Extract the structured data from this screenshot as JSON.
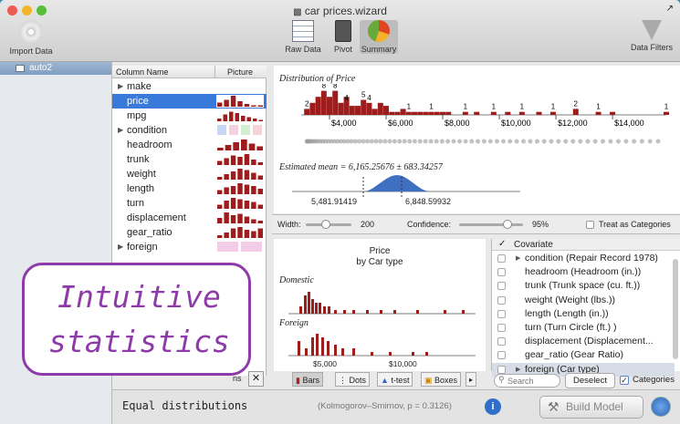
{
  "window": {
    "title": "car prices.wizard"
  },
  "toolbar": {
    "import_label": "Import Data",
    "raw_label": "Raw Data",
    "pivot_label": "Pivot",
    "summary_label": "Summary",
    "filters_label": "Data Filters"
  },
  "sidebar": {
    "items": [
      {
        "label": "auto2"
      }
    ]
  },
  "columns": {
    "header_name": "Column Name",
    "header_picture": "Picture",
    "rows": [
      {
        "name": "make",
        "expandable": true
      },
      {
        "name": "price",
        "selected": true
      },
      {
        "name": "mpg"
      },
      {
        "name": "condition",
        "expandable": true
      },
      {
        "name": "headroom"
      },
      {
        "name": "trunk"
      },
      {
        "name": "weight"
      },
      {
        "name": "length"
      },
      {
        "name": "turn"
      },
      {
        "name": "displacement"
      },
      {
        "name": "gear_ratio"
      },
      {
        "name": "foreign",
        "expandable": true
      }
    ],
    "options_label": "ns"
  },
  "distribution": {
    "title": "Distribution of Price",
    "estimate": "Estimated mean = 6,165.25676 ± 683.34257",
    "ci_low": "5,481.91419",
    "ci_high": "6,848.59932"
  },
  "chart_data": [
    {
      "type": "bar",
      "title": "Distribution of Price",
      "xlabel": "",
      "ylabel": "",
      "x_ticks": [
        "$4,000",
        "$6,000",
        "$8,000",
        "$10,000",
        "$12,000",
        "$14,000"
      ],
      "xlim": [
        3000,
        15900
      ],
      "bins": [
        3200,
        3400,
        3600,
        3800,
        4000,
        4200,
        4400,
        4600,
        4800,
        5000,
        5200,
        5400,
        5600,
        5800,
        6000,
        6200,
        6400,
        6600,
        6800,
        7000,
        7200,
        7400,
        7600,
        7800,
        8000,
        8200,
        8800,
        9200,
        9800,
        10300,
        10800,
        11400,
        11900,
        12700,
        13500,
        14000,
        15900
      ],
      "counts": [
        2,
        4,
        6,
        8,
        6,
        8,
        4,
        6,
        3,
        3,
        5,
        4,
        2,
        4,
        3,
        1,
        1,
        2,
        1,
        1,
        1,
        1,
        1,
        1,
        1,
        1,
        1,
        1,
        1,
        1,
        1,
        1,
        1,
        2,
        1,
        1,
        1
      ],
      "data_labels": [
        {
          "x": 3200,
          "text": "2"
        },
        {
          "x": 3800,
          "text": "8"
        },
        {
          "x": 4200,
          "text": "8"
        },
        {
          "x": 4600,
          "text": "4"
        },
        {
          "x": 5200,
          "text": "5"
        },
        {
          "x": 5400,
          "text": "4"
        },
        {
          "x": 6800,
          "text": "1"
        },
        {
          "x": 7600,
          "text": "1"
        },
        {
          "x": 8800,
          "text": "1"
        },
        {
          "x": 9800,
          "text": "1"
        },
        {
          "x": 10800,
          "text": "1"
        },
        {
          "x": 11900,
          "text": "1"
        },
        {
          "x": 12700,
          "text": "2"
        },
        {
          "x": 13500,
          "text": "1"
        },
        {
          "x": 15900,
          "text": "1"
        }
      ]
    },
    {
      "type": "bar",
      "title": "Price",
      "subtitle": "by Car type",
      "series": [
        {
          "name": "Domestic"
        },
        {
          "name": "Foreign"
        }
      ],
      "x_ticks": [
        "$5,000",
        "$10,000"
      ]
    }
  ],
  "controls": {
    "width_label": "Width:",
    "width_value": "200",
    "confidence_label": "Confidence:",
    "confidence_value": "95%",
    "treat_label": "Treat as Categories"
  },
  "bycar": {
    "title": "Price",
    "subtitle": "by Car type",
    "domestic": "Domestic",
    "foreign": "Foreign"
  },
  "covariates": {
    "header": "Covariate",
    "rows": [
      "condition (Repair Record 1978)",
      "headroom (Headroom (in.))",
      "trunk (Trunk space (cu. ft.))",
      "weight (Weight (lbs.))",
      "length (Length (in.))",
      "turn (Turn Circle (ft.) )",
      "displacement (Displacement...",
      "gear_ratio (Gear Ratio)",
      "foreign (Car type)"
    ],
    "search_placeholder": "Search",
    "deselect": "Deselect",
    "categories": "Categories"
  },
  "tabs": {
    "bars": "Bars",
    "dots": "Dots",
    "ttest": "t-test",
    "boxes": "Boxes"
  },
  "bottom": {
    "status": "Equal distributions",
    "test": "(Kolmogorov–Smirnov, p = 0.3126)",
    "build": "Build Model"
  },
  "badge": {
    "line1": "Intuitive",
    "line2": "statistics"
  }
}
